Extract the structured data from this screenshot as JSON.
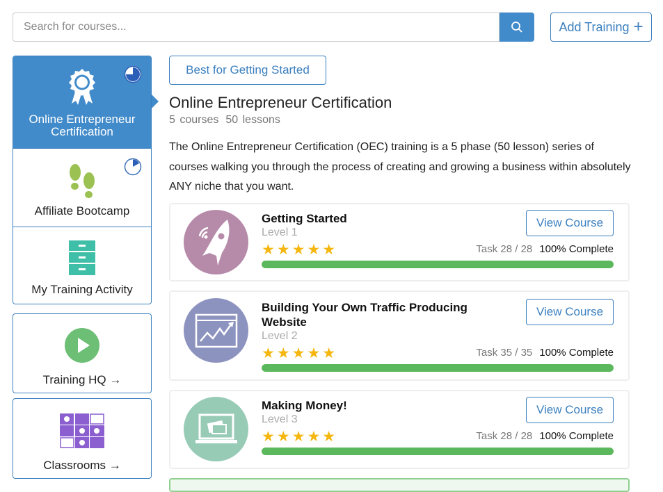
{
  "search": {
    "placeholder": "Search for courses...",
    "icon": "search-icon"
  },
  "add_training": {
    "label": "Add Training",
    "icon": "plus-icon"
  },
  "sidebar": {
    "items": [
      {
        "label": "Online Entrepreneur Certification",
        "icon": "award-ribbon-icon",
        "active": true,
        "progress": 0.75
      },
      {
        "label": "Affiliate Bootcamp",
        "icon": "footprints-icon",
        "progress": 0.2
      },
      {
        "label": "My Training Activity",
        "icon": "file-cabinet-icon"
      }
    ],
    "links": [
      {
        "label": "Training HQ →",
        "icon": "play-icon"
      },
      {
        "label": "Classrooms →",
        "icon": "classroom-grid-icon"
      }
    ]
  },
  "main": {
    "tag": "Best for Getting Started",
    "title": "Online Entrepreneur Certification",
    "courses": "5 courses",
    "lessons": "50 lessons",
    "description": "The Online Entrepreneur Certification (OEC) training is a 5 phase (50 lesson) series of courses walking you through the process of creating and growing a business within absolutely ANY niche that you want.",
    "cards": [
      {
        "title": "Getting Started",
        "level": "Level 1",
        "stars": 5,
        "task": "Task 28 / 28",
        "complete": "100% Complete",
        "progress": 100,
        "button": "View Course",
        "icon": "rocket-icon",
        "color": "#b68aa9"
      },
      {
        "title": "Building Your Own Traffic Producing Website",
        "level": "Level 2",
        "stars": 5,
        "task": "Task 35 / 35",
        "complete": "100% Complete",
        "progress": 100,
        "button": "View Course",
        "icon": "website-chart-icon",
        "color": "#8d93bf"
      },
      {
        "title": "Making Money!",
        "level": "Level 3",
        "stars": 5,
        "task": "Task 28 / 28",
        "complete": "100% Complete",
        "progress": 100,
        "button": "View Course",
        "icon": "laptop-payment-icon",
        "color": "#97cbb6"
      }
    ]
  },
  "colors": {
    "accent": "#428bca",
    "progress": "#5cb85c",
    "star": "#f5b70f"
  }
}
